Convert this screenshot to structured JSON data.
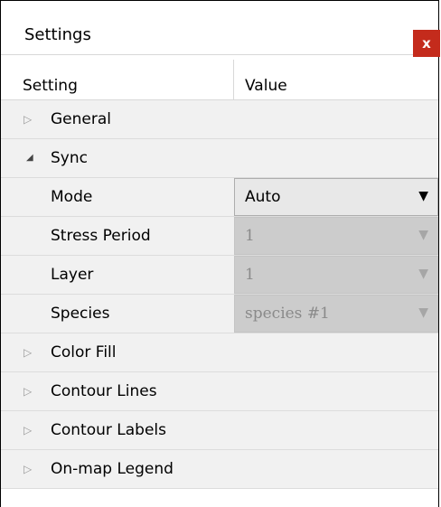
{
  "window": {
    "title": "Settings",
    "close_label": "x"
  },
  "columns": {
    "setting": "Setting",
    "value": "Value"
  },
  "categories": {
    "general": "General",
    "sync": "Sync",
    "color_fill": "Color Fill",
    "contour_lines": "Contour Lines",
    "contour_labels": "Contour Labels",
    "legend": "On-map Legend"
  },
  "sync": {
    "mode": {
      "label": "Mode",
      "value": "Auto"
    },
    "stress_period": {
      "label": "Stress Period",
      "value": "1"
    },
    "layer": {
      "label": "Layer",
      "value": "1"
    },
    "species": {
      "label": "Species",
      "value": "species #1"
    }
  },
  "glyphs": {
    "collapsed": "▷",
    "expanded": "◢",
    "dropdown": "▼"
  },
  "colors": {
    "close_button": "#c42b1c",
    "category_bg": "#f1f1f1",
    "disabled_bg": "#cccccc"
  }
}
